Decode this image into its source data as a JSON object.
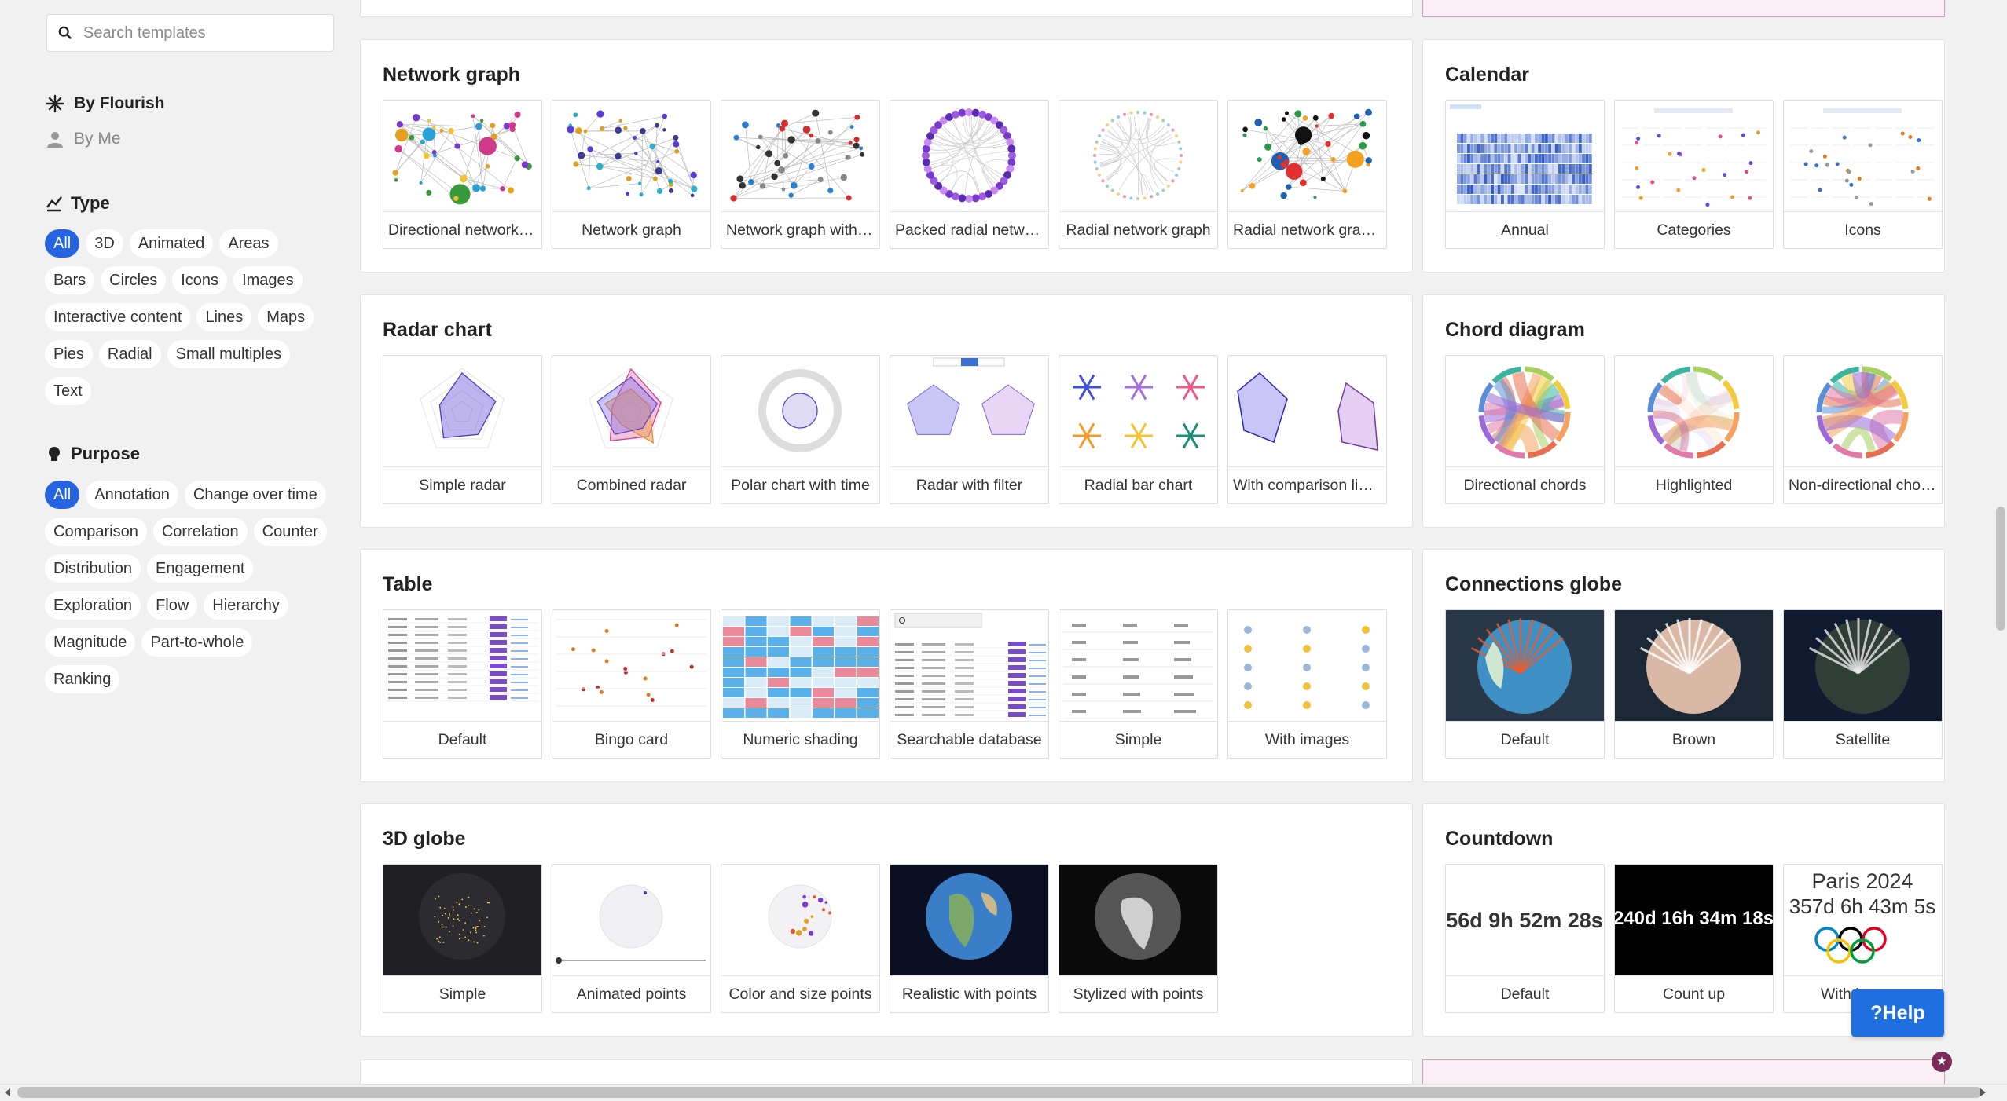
{
  "search": {
    "placeholder": "Search templates"
  },
  "filters": {
    "by_flourish": "By Flourish",
    "by_me": "By Me",
    "type_heading": "Type",
    "type_chips": [
      "All",
      "3D",
      "Animated",
      "Areas",
      "Bars",
      "Circles",
      "Icons",
      "Images",
      "Interactive content",
      "Lines",
      "Maps",
      "Pies",
      "Radial",
      "Small multiples",
      "Text"
    ],
    "type_selected": "All",
    "purpose_heading": "Purpose",
    "purpose_chips": [
      "All",
      "Annotation",
      "Change over time",
      "Comparison",
      "Correlation",
      "Counter",
      "Distribution",
      "Engagement",
      "Exploration",
      "Flow",
      "Hierarchy",
      "Magnitude",
      "Part-to-whole",
      "Ranking"
    ],
    "purpose_selected": "All"
  },
  "sections": {
    "network": {
      "title": "Network graph",
      "cards": [
        "Directional network graph",
        "Network graph",
        "Network graph with images",
        "Packed radial network",
        "Radial network graph",
        "Radial network graph with images"
      ]
    },
    "calendar": {
      "title": "Calendar",
      "cards": [
        "Annual",
        "Categories",
        "Icons"
      ]
    },
    "radar": {
      "title": "Radar chart",
      "cards": [
        "Simple radar",
        "Combined radar",
        "Polar chart with time",
        "Radar with filter",
        "Radial bar chart",
        "With comparison lines"
      ]
    },
    "chord": {
      "title": "Chord diagram",
      "cards": [
        "Directional chords",
        "Highlighted",
        "Non-directional chords"
      ]
    },
    "table": {
      "title": "Table",
      "cards": [
        "Default",
        "Bingo card",
        "Numeric shading",
        "Searchable database",
        "Simple",
        "With images"
      ]
    },
    "globe_conn": {
      "title": "Connections globe",
      "cards": [
        "Default",
        "Brown",
        "Satellite"
      ]
    },
    "globe3d": {
      "title": "3D globe",
      "cards": [
        "Simple",
        "Animated points",
        "Color and size points",
        "Realistic with points",
        "Stylized with points"
      ]
    },
    "countdown": {
      "title": "Countdown",
      "cards": [
        "Default",
        "Count up",
        "With images"
      ],
      "thumb_texts": {
        "default": "56d 9h 52m 28s",
        "count_up": "240d 16h 34m 18s",
        "paris_title": "Paris 2024",
        "paris_timer": "357d 6h 43m 5s"
      }
    }
  },
  "help": {
    "label": "Help",
    "icon": "question-mark-icon"
  },
  "colors": {
    "accent": "#2563e0",
    "help": "#1f6fe0"
  }
}
